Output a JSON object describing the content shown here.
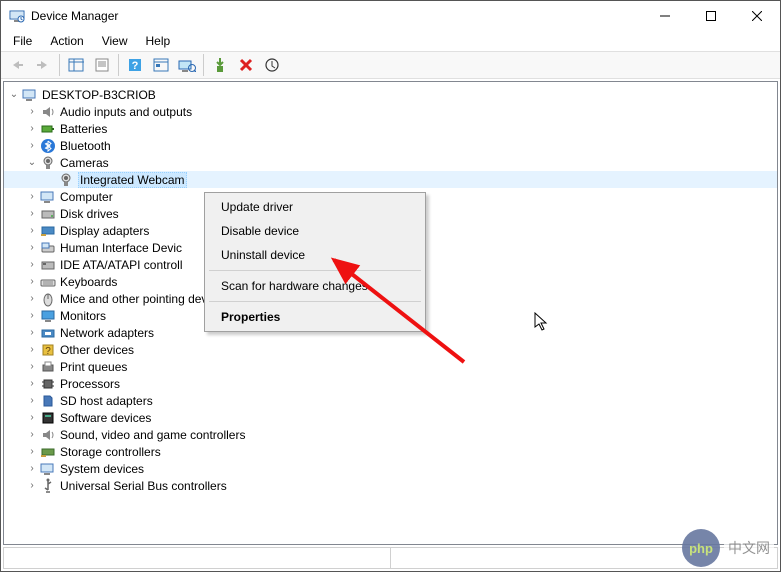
{
  "window": {
    "title": "Device Manager"
  },
  "menus": {
    "file": "File",
    "action": "Action",
    "view": "View",
    "help": "Help"
  },
  "tree": {
    "root": "DESKTOP-B3CRIOB",
    "items": [
      {
        "label": "Audio inputs and outputs",
        "expanded": false
      },
      {
        "label": "Batteries",
        "expanded": false
      },
      {
        "label": "Bluetooth",
        "expanded": false
      },
      {
        "label": "Cameras",
        "expanded": true,
        "children": [
          {
            "label": "Integrated Webcam",
            "selected": true
          }
        ]
      },
      {
        "label": "Computer",
        "expanded": false
      },
      {
        "label": "Disk drives",
        "expanded": false
      },
      {
        "label": "Display adapters",
        "expanded": false
      },
      {
        "label": "Human Interface Devices",
        "truncated": "Human Interface Devic",
        "expanded": false
      },
      {
        "label": "IDE ATA/ATAPI controllers",
        "truncated": "IDE ATA/ATAPI controll",
        "expanded": false
      },
      {
        "label": "Keyboards",
        "expanded": false
      },
      {
        "label": "Mice and other pointing devices",
        "expanded": false
      },
      {
        "label": "Monitors",
        "expanded": false
      },
      {
        "label": "Network adapters",
        "expanded": false
      },
      {
        "label": "Other devices",
        "expanded": false
      },
      {
        "label": "Print queues",
        "expanded": false
      },
      {
        "label": "Processors",
        "expanded": false
      },
      {
        "label": "SD host adapters",
        "expanded": false
      },
      {
        "label": "Software devices",
        "expanded": false
      },
      {
        "label": "Sound, video and game controllers",
        "expanded": false
      },
      {
        "label": "Storage controllers",
        "expanded": false
      },
      {
        "label": "System devices",
        "expanded": false
      },
      {
        "label": "Universal Serial Bus controllers",
        "expanded": false
      }
    ]
  },
  "context_menu": {
    "update": "Update driver",
    "disable": "Disable device",
    "uninstall": "Uninstall device",
    "scan": "Scan for hardware changes",
    "properties": "Properties"
  },
  "watermark": {
    "logo": "php",
    "text": "中文网"
  }
}
